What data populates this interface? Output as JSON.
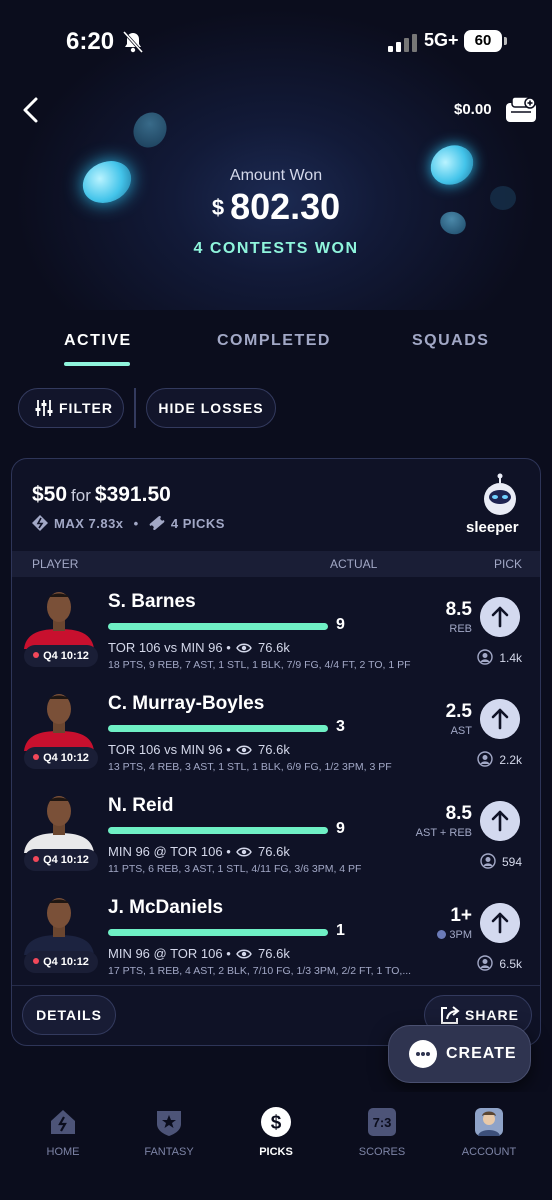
{
  "status_bar": {
    "time": "6:20",
    "network": "5G+",
    "battery": "60"
  },
  "header": {
    "balance": "$0.00"
  },
  "summary": {
    "label": "Amount Won",
    "currency": "$",
    "amount": "802.30",
    "contests_won": "4 CONTESTS WON"
  },
  "tabs": [
    {
      "label": "ACTIVE",
      "active": true
    },
    {
      "label": "COMPLETED",
      "active": false
    },
    {
      "label": "SQUADS",
      "active": false
    }
  ],
  "filters": {
    "filter_label": "FILTER",
    "hide_losses_label": "HIDE LOSSES"
  },
  "entry": {
    "stake": "$50",
    "for_label": "for",
    "payout": "$391.50",
    "max_label": "MAX 7.83x",
    "picks_label": "4 PICKS",
    "brand": "sleeper",
    "columns": {
      "player": "PLAYER",
      "actual": "ACTUAL",
      "pick": "PICK"
    },
    "rows": [
      {
        "name": "S. Barnes",
        "actual": "9",
        "progress": 1.0,
        "matchup": "TOR 106 vs MIN 96 •",
        "views": "76.6k",
        "stats": "18 PTS, 9 REB, 7 AST, 1 STL, 1 BLK, 7/9 FG, 4/4 FT, 2 TO, 1 PF",
        "line": "8.5",
        "stat_type": "REB",
        "pick_count": "1.4k",
        "clock": "Q4 10:12",
        "jersey_color": "#c8102e"
      },
      {
        "name": "C. Murray-Boyles",
        "actual": "3",
        "progress": 1.0,
        "matchup": "TOR 106 vs MIN 96 •",
        "views": "76.6k",
        "stats": "13 PTS, 4 REB, 3 AST, 1 STL, 1 BLK, 6/9 FG, 1/2 3PM, 3 PF",
        "line": "2.5",
        "stat_type": "AST",
        "pick_count": "2.2k",
        "clock": "Q4 10:12",
        "jersey_color": "#c8102e"
      },
      {
        "name": "N. Reid",
        "actual": "9",
        "progress": 1.0,
        "matchup": "MIN 96 @ TOR 106 •",
        "views": "76.6k",
        "stats": "11 PTS, 6 REB, 3 AST, 1 STL, 4/11 FG, 3/6 3PM, 4 PF",
        "line": "8.5",
        "stat_type": "AST + REB",
        "pick_count": "594",
        "clock": "Q4 10:12",
        "jersey_color": "#e8e8ea"
      },
      {
        "name": "J. McDaniels",
        "actual": "1",
        "progress": 1.0,
        "matchup": "MIN 96 @ TOR 106 •",
        "views": "76.6k",
        "stats": "17 PTS, 1 REB, 4 AST, 2 BLK, 7/10 FG, 1/3 3PM, 2/2 FT, 1 TO,...",
        "line": "1+",
        "stat_type": "3PM",
        "pick_count": "6.5k",
        "clock": "Q4 10:12",
        "jersey_color": "#1c2340"
      }
    ],
    "details_label": "DETAILS",
    "share_label": "SHARE"
  },
  "create_label": "CREATE",
  "nav": [
    {
      "label": "HOME",
      "icon": "home-icon",
      "active": false
    },
    {
      "label": "FANTASY",
      "icon": "shield-star-icon",
      "active": false
    },
    {
      "label": "PICKS",
      "icon": "dollar-icon",
      "active": true
    },
    {
      "label": "SCORES",
      "icon": "scoreboard-icon",
      "active": false,
      "badge": "7:3"
    },
    {
      "label": "ACCOUNT",
      "icon": "avatar-icon",
      "active": false
    }
  ]
}
